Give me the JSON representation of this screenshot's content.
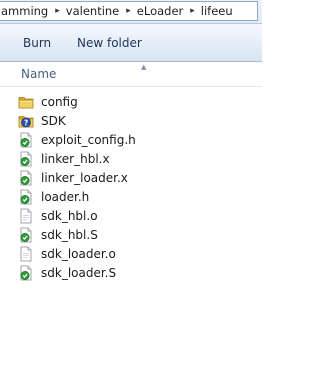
{
  "breadcrumb": {
    "items": [
      "amming",
      "valentine",
      "eLoader",
      "lifeeu"
    ],
    "separator": "▸"
  },
  "commandbar": {
    "burn_label": "Burn",
    "new_folder_label": "New folder"
  },
  "columns": {
    "name_label": "Name",
    "sort_indicator": "▲"
  },
  "files": [
    {
      "name": "config",
      "icon": "folder-icon"
    },
    {
      "name": "SDK",
      "icon": "help-folder-icon"
    },
    {
      "name": "exploit_config.h",
      "icon": "c-source-icon"
    },
    {
      "name": "linker_hbl.x",
      "icon": "c-source-icon"
    },
    {
      "name": "linker_loader.x",
      "icon": "c-source-icon"
    },
    {
      "name": "loader.h",
      "icon": "c-source-icon"
    },
    {
      "name": "sdk_hbl.o",
      "icon": "generic-file-icon"
    },
    {
      "name": "sdk_hbl.S",
      "icon": "c-source-icon"
    },
    {
      "name": "sdk_loader.o",
      "icon": "generic-file-icon"
    },
    {
      "name": "sdk_loader.S",
      "icon": "c-source-icon"
    }
  ],
  "colors": {
    "folder": "#e9c34a",
    "help_badge": "#2b4fa8",
    "source_badge": "#2f9b3b",
    "command_text": "#1e3355"
  }
}
